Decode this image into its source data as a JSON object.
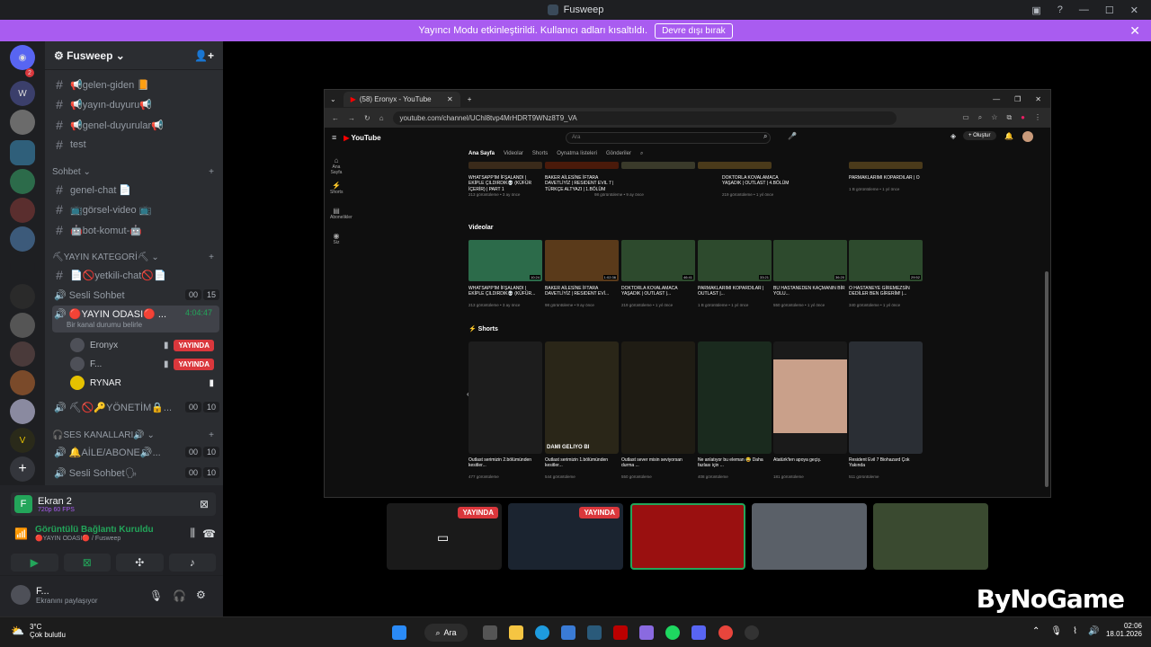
{
  "window": {
    "title": "Fusweep"
  },
  "streamer_banner": {
    "text": "Yayıncı Modu etkinleştirildi. Kullanıcı adları kısaltıldı.",
    "button": "Devre dışı bırak"
  },
  "server": {
    "name": "Fusweep"
  },
  "channels": {
    "text_top": [
      "📢gelen-giden 📙",
      "📢yayın-duyuru📢",
      "📢genel-duyurular📢",
      "test"
    ],
    "cat_sohbet": "Sohbet",
    "sohbet": [
      "genel-chat 📄",
      "📺görsel-video 📺",
      "🤖bot-komut-🤖"
    ],
    "cat_yayin": "⛏YAYIN KATEGORİ⛏",
    "yetkili": "📄🚫yetkili-chat🚫📄",
    "sesli": {
      "name": "Sesli Sohbet",
      "count_a": "00",
      "count_b": "15"
    },
    "yayin_odasi": {
      "name": "🔴YAYIN ODASI🔴 ...",
      "timer": "4:04:47",
      "status": "Bir kanal durumu belirle"
    },
    "users": [
      {
        "name": "Eronyx",
        "badge": "YAYINDA"
      },
      {
        "name": "F...",
        "badge": "YAYINDA"
      },
      {
        "name": "RYNAR",
        "badge": ""
      }
    ],
    "yonetim": {
      "name": "⛏🚫🔑YÖNETİM🔒...",
      "count_a": "00",
      "count_b": "10"
    },
    "cat_ses": "🎧SES KANALLARI🔊",
    "aile": {
      "name": "🔔AİLE/ABONE🔊...",
      "count_a": "00",
      "count_b": "10"
    },
    "sesli2": {
      "name": "Sesli Sohbet🗣",
      "count_a": "00",
      "count_b": "10"
    }
  },
  "voice": {
    "screen_title": "Ekran 2",
    "screen_quality": "720p 60 FPS",
    "status": "Görüntülü Bağlantı Kuruldu",
    "location": "🔴YAYIN ODASI🔴 / Fusweep"
  },
  "user": {
    "name": "F...",
    "status": "Ekranını paylaşıyor"
  },
  "browser": {
    "tab_title": "(58) Eronyx - YouTube",
    "url": "youtube.com/channel/UChl8tvp4MrHDRT9WNz8T9_VA",
    "search_placeholder": "Ara",
    "create_label": "Oluştur",
    "tabs": [
      "Ana Sayfa",
      "Videolar",
      "Shorts",
      "Oynatma listeleri",
      "Gönderiler"
    ],
    "nav": [
      "Ana Sayfa",
      "Shorts",
      "Abonelikler",
      "Siz"
    ],
    "top_row": [
      {
        "title": "WHATSAPP'IM İFŞALANDI | EKİPLE ÇILDIRDIK💀 (KÜFÜR İÇERİR) | PART 1",
        "meta": "213 görüntüleme • 3 ay önce"
      },
      {
        "title": "BAKER AİLESİNE İFTARA DAVETLİYİZ | RESIDENT EVIL 7 | TÜRKÇE ALTYAZI | 1.BÖLÜM",
        "meta": "98 görüntüleme • 9 ay önce"
      },
      {
        "title": "DOKTORLA KOVALAMACA YAŞADIK | OUTLAST | 4.BÖLÜM",
        "meta": "219 görüntüleme • 1 yıl önce"
      },
      {
        "title": "PARMAKLARIMI KOPARDILAR | O",
        "meta": "1 B görüntüleme • 1 yıl önce"
      }
    ],
    "videos_heading": "Videolar",
    "videos": [
      {
        "title": "WHATSAPP'IM İFŞALANDI | EKİPLE ÇILDIRDIK💀 (KÜFÜR...",
        "meta": "213 görüntüleme • 3 ay önce",
        "dur": "10:24"
      },
      {
        "title": "BAKER AİLESİNE İFTARA DAVETLİYİZ | RESIDENT EVİ...",
        "meta": "98 görüntüleme • 9 ay önce",
        "dur": "1:02:36"
      },
      {
        "title": "DOKTORLA KOVALAMACA YAŞADIK | OUTLAST |...",
        "meta": "219 görüntüleme • 1 yıl önce",
        "dur": "46:41"
      },
      {
        "title": "PARMAKLARIMI KOPARDILAR | OUTLAST |...",
        "meta": "1 B görüntüleme • 1 yıl önce",
        "dur": "33:21"
      },
      {
        "title": "BU HASTANEDEN KAÇMANIN BİR YOLU...",
        "meta": "550 görüntüleme • 1 yıl önce",
        "dur": "36:20"
      },
      {
        "title": "O HASTANEYE GİREMEZSİN DEDİLER BEN GİRERİM! |...",
        "meta": "340 görüntüleme • 1 yıl önce",
        "dur": "29:52"
      }
    ],
    "shorts_heading": "Shorts",
    "shorts": [
      {
        "title": "Outlast serimizin 2.bölümünden kesitler...",
        "meta": "477 görüntüleme"
      },
      {
        "title": "Outlast serimizin 1.bölümünden kesitler...",
        "meta": "544 görüntüleme"
      },
      {
        "title": "Outlast sever misin seviyorsan durma ...",
        "meta": "550 görüntüleme"
      },
      {
        "title": "Ne anlatıyor bu eleman 😂 Daha fazlası için ...",
        "meta": "408 görüntüleme"
      },
      {
        "title": "Atatürk'ten apoya geçiş.",
        "meta": "181 görüntüleme"
      },
      {
        "title": "Resident Evil 7 Biohazard Çok Yakında",
        "meta": "511 görüntüleme"
      }
    ],
    "short_overlay": "DAMI GELIYO BI"
  },
  "strip": {
    "live_label": "YAYINDA"
  },
  "weather": {
    "temp": "3°C",
    "desc": "Çok bulutlu"
  },
  "taskbar": {
    "search": "Ara",
    "time": "02:06",
    "date": "18.01.2026"
  },
  "watermark": "ByNoGame",
  "colors": {
    "accent": "#a95cf0",
    "live": "#da373c",
    "online": "#23a55a",
    "discord_bg": "#2b2d31"
  }
}
